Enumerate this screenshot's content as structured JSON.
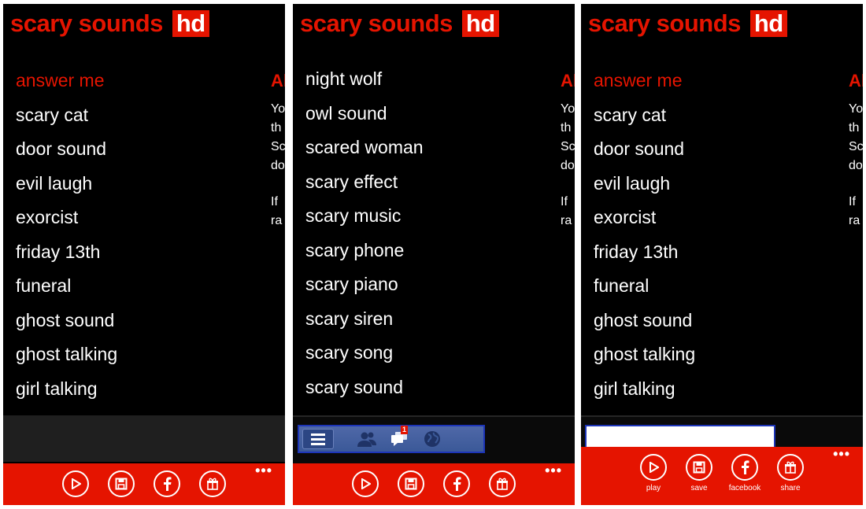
{
  "app": {
    "title": "scary sounds",
    "badge": "hd"
  },
  "peek": {
    "heading": "Al",
    "lines_top": [
      "Yo",
      "th",
      "Sc",
      "do"
    ],
    "lines_bottom": [
      "If",
      "ra"
    ]
  },
  "screens": [
    {
      "sounds": [
        "answer me",
        "scary cat",
        "door sound",
        "evil laugh",
        "exorcist",
        "friday 13th",
        "funeral",
        "ghost sound",
        "ghost talking",
        "girl talking"
      ],
      "selected_index": 0
    },
    {
      "sounds": [
        "night wolf",
        "owl sound",
        "scared woman",
        "scary effect",
        "scary music",
        "scary phone",
        "scary piano",
        "scary siren",
        "scary song",
        "scary sound"
      ],
      "selected_index": -1,
      "ad_notification_count": "1"
    },
    {
      "sounds": [
        "answer me",
        "scary cat",
        "door sound",
        "evil laugh",
        "exorcist",
        "friday 13th",
        "funeral",
        "ghost sound",
        "ghost talking",
        "girl talking"
      ],
      "selected_index": 0
    }
  ],
  "app_bar": {
    "buttons": [
      {
        "icon": "play-icon",
        "label": "play"
      },
      {
        "icon": "save-icon",
        "label": "save"
      },
      {
        "icon": "facebook-icon",
        "label": "facebook"
      },
      {
        "icon": "gift-icon",
        "label": "share"
      }
    ],
    "more": "•••"
  },
  "colors": {
    "accent": "#e51400",
    "background": "#000000",
    "facebook": "#3b5998"
  }
}
